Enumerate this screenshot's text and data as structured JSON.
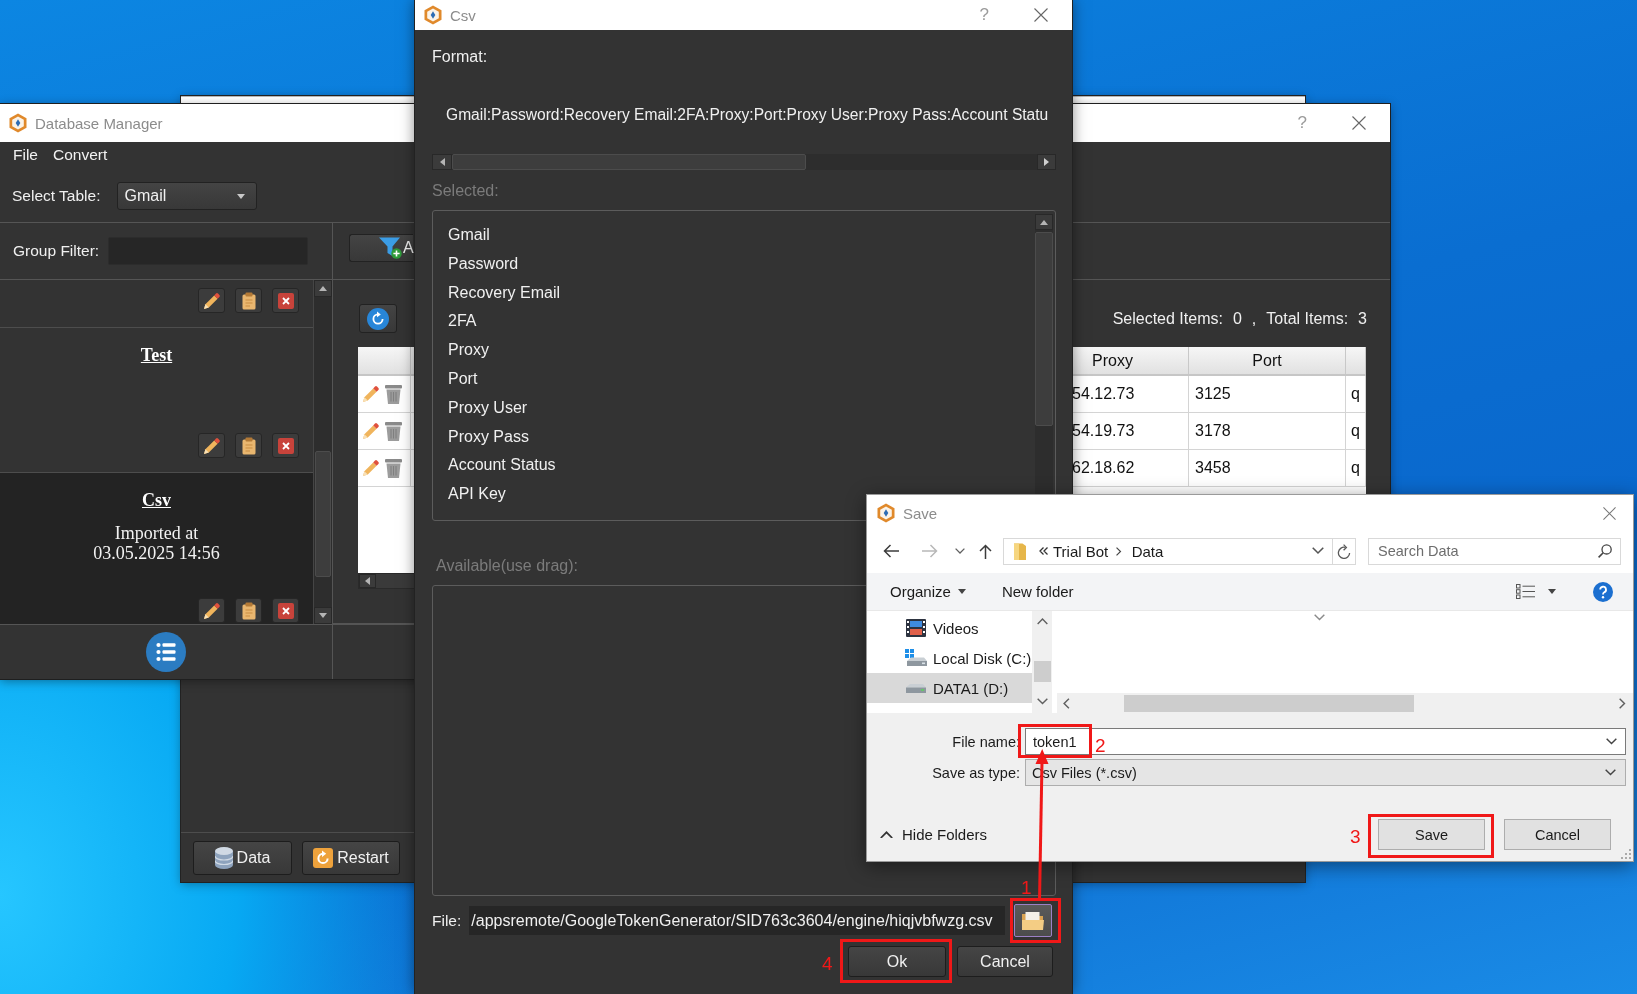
{
  "background_window": {
    "buttons": [
      {
        "label": "Data"
      },
      {
        "label": "Restart"
      }
    ]
  },
  "database_manager": {
    "title": "Database Manager",
    "help": "?",
    "menu": [
      "File",
      "Convert"
    ],
    "select_table": {
      "label": "Select Table:",
      "value": "Gmail"
    },
    "group_filter": {
      "label": "Group Filter:"
    },
    "groups": [
      {
        "selected": false
      },
      {
        "name": "Test",
        "selected": false
      },
      {
        "name": "Csv",
        "lines": [
          "Imported at",
          "03.05.2025 14:56"
        ],
        "selected": true
      }
    ],
    "filter_button": "A",
    "counts": {
      "selected_label": "Selected Items:",
      "selected_value": "0",
      "separator": ",",
      "total_label": "Total Items:",
      "total_value": "3"
    },
    "table": {
      "columns": [
        "Proxy",
        "Port"
      ],
      "rows": [
        [
          "54.12.73",
          "3125",
          "q"
        ],
        [
          "54.19.73",
          "3178",
          "q"
        ],
        [
          "62.18.62",
          "3458",
          "q"
        ]
      ]
    }
  },
  "csv_dialog": {
    "title": "Csv",
    "help": "?",
    "format_label": "Format:",
    "format": "Gmail:Password:Recovery Email:2FA:Proxy:Port:Proxy User:Proxy Pass:Account Statu",
    "selected_label": "Selected:",
    "selected_fields": [
      "Gmail",
      "Password",
      "Recovery Email",
      "2FA",
      "Proxy",
      "Port",
      "Proxy User",
      "Proxy Pass",
      "Account Status",
      "API Key"
    ],
    "available_label": "Available(use drag):",
    "file_label": "File:",
    "file_path": "/appsremote/GoogleTokenGenerator/SID763c3604/engine/hiqjvbfwzg.csv",
    "buttons": [
      "Ok",
      "Cancel"
    ]
  },
  "save_dialog": {
    "title": "Save",
    "breadcrumb": [
      "Trial Bot",
      "Data"
    ],
    "search": {
      "placeholder": "Search Data"
    },
    "toolbar": [
      {
        "label": "Organize",
        "kind": "menu"
      },
      {
        "label": "New folder",
        "kind": "button"
      }
    ],
    "folders": [
      {
        "label": "Videos",
        "selected": false
      },
      {
        "label": "Local Disk (C:)",
        "selected": false
      },
      {
        "label": "DATA1 (D:)",
        "selected": true
      }
    ],
    "file_name": {
      "label": "File name:",
      "value": "token1"
    },
    "save_as_type": {
      "label": "Save as type:",
      "value": "Csv Files (*.csv)"
    },
    "hide_folders": "Hide Folders",
    "buttons": [
      "Save",
      "Cancel"
    ]
  },
  "annotations": [
    "1",
    "2",
    "3",
    "4"
  ]
}
